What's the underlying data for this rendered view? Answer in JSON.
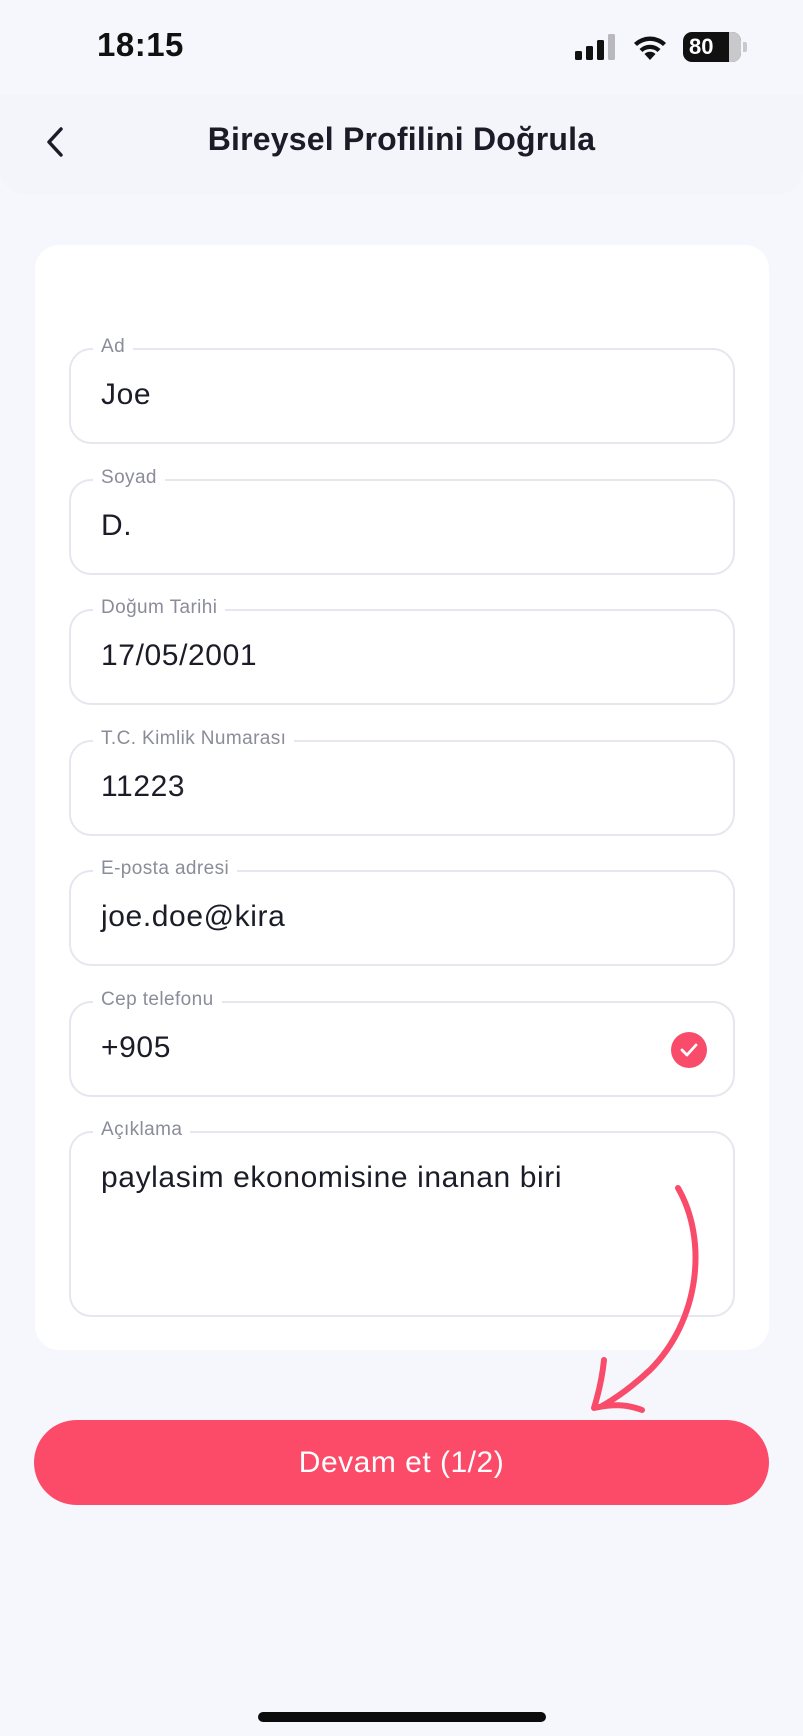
{
  "status_bar": {
    "time": "18:15",
    "battery_level": "80",
    "icons": [
      "signal-icon",
      "wifi-icon",
      "battery-icon"
    ]
  },
  "header": {
    "title": "Bireysel Profilini Doğrula",
    "back_icon": "chevron-left-icon"
  },
  "form": {
    "fields": [
      {
        "label": "Ad",
        "value": "Joe"
      },
      {
        "label": "Soyad",
        "value": "D."
      },
      {
        "label": "Doğum Tarihi",
        "value": "17/05/2001"
      },
      {
        "label": "T.C. Kimlik Numarası",
        "value": "11223"
      },
      {
        "label": "E-posta adresi",
        "value": "joe.doe@kira"
      },
      {
        "label": "Cep telefonu",
        "value": "+905",
        "verified": true
      },
      {
        "label": "Açıklama",
        "value": "paylasim ekonomisine inanan biri"
      }
    ]
  },
  "continue_button": {
    "label": "Devam et (1/2)"
  },
  "colors": {
    "accent": "#fb4b69",
    "background": "#f6f7fc",
    "card": "#ffffff",
    "field_border": "#e6e7ee",
    "label": "#8a8c99",
    "text": "#1b1c27"
  }
}
